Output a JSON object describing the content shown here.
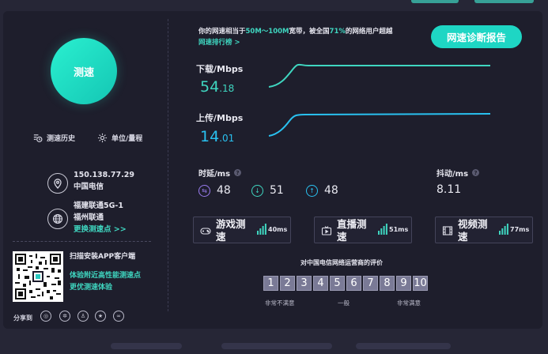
{
  "left": {
    "speed_button": "测速",
    "history_label": "测速历史",
    "unit_label": "单位/量程",
    "ip_address": "150.138.77.29",
    "isp": "中国电信",
    "node_name": "福建联通5G-1",
    "node_city": "福州联通",
    "change_node": "更换测速点 >>",
    "qr_title": "扫描安装APP客户端",
    "qr_line1": "体验附近高性能测速点",
    "qr_line2": "更优测速体验",
    "share_label": "分享到"
  },
  "rank": {
    "prefix": "你的网速相当于",
    "bandwidth": "50M～100M",
    "middle": "宽带，被全国",
    "percent": "71%",
    "suffix": "的网络用户超越",
    "link": "网速排行榜 >"
  },
  "diagnose_button": "网速诊断报告",
  "download": {
    "label": "下载/Mbps",
    "int": "54",
    "dec": ".18"
  },
  "upload": {
    "label": "上传/Mbps",
    "int": "14",
    "dec": ".01"
  },
  "latency": {
    "label": "时延/ms",
    "overall": "48",
    "down": "51",
    "up": "48"
  },
  "jitter": {
    "label": "抖动/ms",
    "value": "8.11"
  },
  "tests": [
    {
      "name": "游戏测速",
      "ms": "40ms"
    },
    {
      "name": "直播测速",
      "ms": "51ms"
    },
    {
      "name": "视频测速",
      "ms": "77ms"
    }
  ],
  "rating": {
    "title": "对中国电信网络运营商的评价",
    "scores": [
      "1",
      "2",
      "3",
      "4",
      "5",
      "6",
      "7",
      "8",
      "9",
      "10"
    ],
    "low": "非常不满意",
    "mid": "一般",
    "high": "非常满意"
  },
  "colors": {
    "accent": "#1ed6c4",
    "download_line": "#3fd6c0",
    "upload_line": "#29c1f0",
    "background": "#1e1e2c"
  }
}
